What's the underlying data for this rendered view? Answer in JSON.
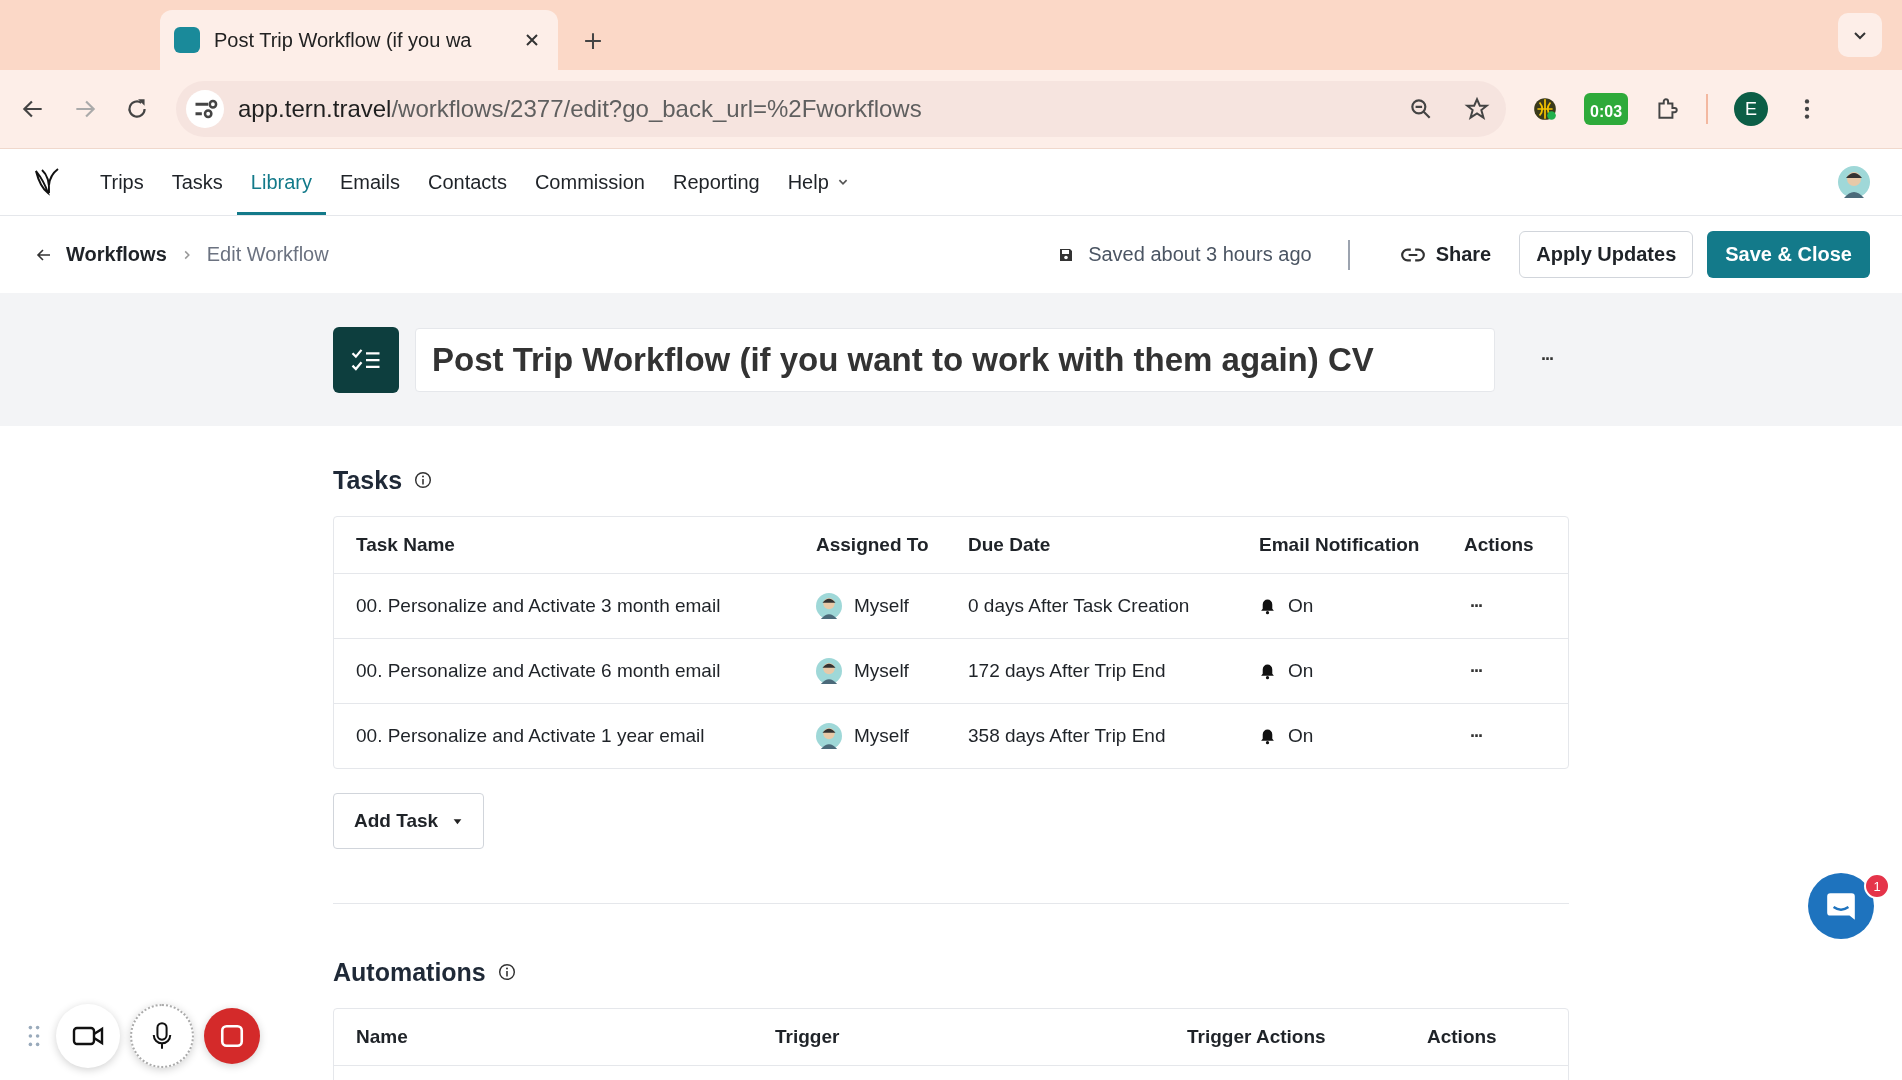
{
  "browser": {
    "tab_title": "Post Trip Workflow (if you wa",
    "url_host": "app.tern.travel",
    "url_path": "/workflows/2377/edit?go_back_url=%2Fworkflows",
    "timer": "0:03",
    "profile": "E"
  },
  "nav": [
    {
      "label": "Trips",
      "selected": false
    },
    {
      "label": "Tasks",
      "selected": false
    },
    {
      "label": "Library",
      "selected": true
    },
    {
      "label": "Emails",
      "selected": false
    },
    {
      "label": "Contacts",
      "selected": false
    },
    {
      "label": "Commission",
      "selected": false
    },
    {
      "label": "Reporting",
      "selected": false
    },
    {
      "label": "Help",
      "selected": false,
      "kind": "menu"
    }
  ],
  "breadcrumb": {
    "parent": "Workflows",
    "current": "Edit Workflow"
  },
  "toolbar": {
    "save_status": "Saved about 3 hours ago",
    "share": "Share",
    "apply": "Apply Updates",
    "save_close": "Save & Close"
  },
  "workflow": {
    "title": "Post Trip Workflow (if you want to work with them again) CV",
    "menu": "···"
  },
  "tasks": {
    "heading": "Tasks",
    "columns": [
      "Task Name",
      "Assigned To",
      "Due Date",
      "Email Notification",
      "Actions"
    ],
    "rows": [
      {
        "name": "00. Personalize and Activate 3 month email",
        "assignee": "Myself",
        "due": "0 days After Task Creation",
        "notification": "On",
        "actions": "···"
      },
      {
        "name": "00. Personalize and Activate 6 month email",
        "assignee": "Myself",
        "due": "172 days After Trip End",
        "notification": "On",
        "actions": "···"
      },
      {
        "name": "00. Personalize and Activate 1 year email",
        "assignee": "Myself",
        "due": "358 days After Trip End",
        "notification": "On",
        "actions": "···"
      }
    ],
    "add_button": "Add Task"
  },
  "automations": {
    "heading": "Automations",
    "columns": [
      "Name",
      "Trigger",
      "Trigger Actions",
      "Actions"
    ]
  },
  "chat": {
    "badge": "1"
  }
}
